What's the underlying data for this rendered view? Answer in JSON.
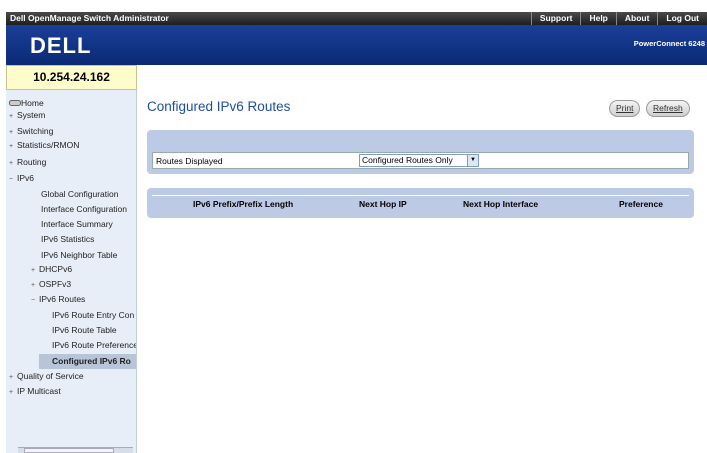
{
  "topbar": {
    "title": "Dell OpenManage Switch Administrator",
    "menu": [
      "Support",
      "Help",
      "About",
      "Log Out"
    ]
  },
  "header": {
    "brand": "DELL",
    "product": "PowerConnect 6248"
  },
  "device": {
    "ip": "10.254.24.162"
  },
  "sidebar": {
    "items": [
      {
        "label": "Home",
        "glyph": ""
      },
      {
        "label": "System",
        "glyph": "+"
      },
      {
        "label": "Switching",
        "glyph": "+"
      },
      {
        "label": "Statistics/RMON",
        "glyph": "+"
      },
      {
        "label": "Routing",
        "glyph": "+"
      },
      {
        "label": "IPv6",
        "glyph": "−"
      },
      {
        "label": "Global Configuration",
        "glyph": ""
      },
      {
        "label": "Interface Configuration",
        "glyph": ""
      },
      {
        "label": "Interface Summary",
        "glyph": ""
      },
      {
        "label": "IPv6 Statistics",
        "glyph": ""
      },
      {
        "label": "IPv6 Neighbor Table",
        "glyph": ""
      },
      {
        "label": "DHCPv6",
        "glyph": "+"
      },
      {
        "label": "OSPFv3",
        "glyph": "+"
      },
      {
        "label": "IPv6 Routes",
        "glyph": "−"
      },
      {
        "label": "IPv6 Route Entry Con",
        "glyph": ""
      },
      {
        "label": "IPv6 Route Table",
        "glyph": ""
      },
      {
        "label": "IPv6 Route Preference",
        "glyph": ""
      },
      {
        "label": "Configured IPv6 Ro",
        "glyph": ""
      },
      {
        "label": "Quality of Service",
        "glyph": "+"
      },
      {
        "label": "IP Multicast",
        "glyph": "+"
      }
    ]
  },
  "main": {
    "title": "Configured IPv6 Routes",
    "print_label": "Print",
    "refresh_label": "Refresh",
    "routes_label": "Routes Displayed",
    "routes_value": "Configured Routes Only",
    "columns": [
      "IPv6 Prefix/Prefix Length",
      "Next Hop IP",
      "Next Hop Interface",
      "Preference"
    ]
  }
}
